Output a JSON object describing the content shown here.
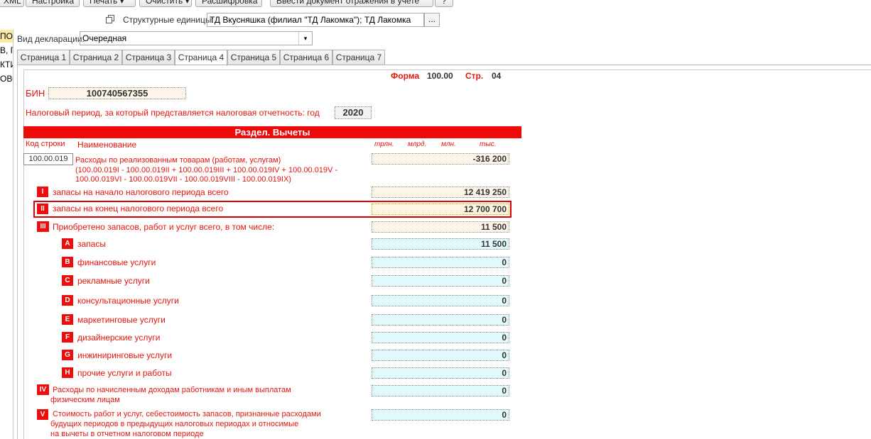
{
  "toolbar": {
    "xml_label": "XML",
    "settings_label": "Настройка",
    "print_label": "Печать ▾",
    "clear_label": "Очистить ▾",
    "decode_label": "Расшифровка",
    "enter_doc_label": "Ввести документ отражения в учете",
    "help_label": "?"
  },
  "structure": {
    "label": "Структурные единицы:",
    "value": "ТД Вкусняшка (филиал \"ТД Лакомка\"); ТД Лакомка",
    "btn": "..."
  },
  "sidebar": {
    "items": [
      "ПО",
      "В, Г",
      "КТИ",
      "ОВС"
    ]
  },
  "declaration": {
    "label": "Вид декларации:",
    "value": "Очередная"
  },
  "tabs": [
    "Страница 1",
    "Страница 2",
    "Страница 3",
    "Страница 4",
    "Страница 5",
    "Страница 6",
    "Страница 7"
  ],
  "active_tab": "Страница 4",
  "form": {
    "form_label": "Форма",
    "form_number": "100.00",
    "page_label": "Стр.",
    "page_number": "04",
    "bin_label": "БИН",
    "bin_value": "100740567355",
    "period_label": "Налоговый период, за который представляется налоговая отчетность: год",
    "period_value": "2020",
    "section_title": "Раздел. Вычеты",
    "col_code": "Код строки",
    "col_name": "Наименование",
    "units": [
      "трлн.",
      "млрд.",
      "млн.",
      "тыс."
    ],
    "main_row": {
      "code": "100.00.019",
      "text1": "Расходы по реализованным товарам (работам, услугам)",
      "text2": "(100.00.019I - 100.00.019II + 100.00.019III + 100.00.019IV + 100.00.019V -",
      "text3": "100.00.019VI - 100.00.019VII - 100.00.019VIII - 100.00.019IX)",
      "value": "-316 200"
    },
    "rows": {
      "r1": {
        "badge": "I",
        "text": "запасы на начало налогового периода всего",
        "value": "12 419 250"
      },
      "r2": {
        "badge": "II",
        "text": "запасы на конец налогового периода всего",
        "value": "12 700 700"
      },
      "r3": {
        "badge": "III",
        "text": "Приобретено запасов, работ и услуг всего,  в том числе:",
        "value": "11 500"
      },
      "a": {
        "badge": "A",
        "text": "запасы",
        "value": "11 500"
      },
      "b": {
        "badge": "B",
        "text": "финансовые услуги",
        "value": "0"
      },
      "c": {
        "badge": "C",
        "text": "рекламные услуги",
        "value": "0"
      },
      "d": {
        "badge": "D",
        "text": "консультационные услуги",
        "value": "0"
      },
      "e": {
        "badge": "E",
        "text": "маркетинговые услуги",
        "value": "0"
      },
      "f": {
        "badge": "F",
        "text": "дизайнерские услуги",
        "value": "0"
      },
      "g": {
        "badge": "G",
        "text": "инжиниринговые услуги",
        "value": "0"
      },
      "h": {
        "badge": "H",
        "text": "прочие услуги и работы",
        "value": "0"
      },
      "r4": {
        "badge": "IV",
        "text1": "Расходы по начисленным доходам работникам и иным выплатам",
        "text2": "физическим лицам",
        "value": "0"
      },
      "r5": {
        "badge": "V",
        "text1": "Стоимость работ и услуг, себестоимость запасов, признанные расходами",
        "text2": "будущих периодов в предыдущих налоговых периодах и относимые",
        "text3": "на вычеты в отчетном налоговом периоде",
        "value": "0"
      }
    }
  }
}
